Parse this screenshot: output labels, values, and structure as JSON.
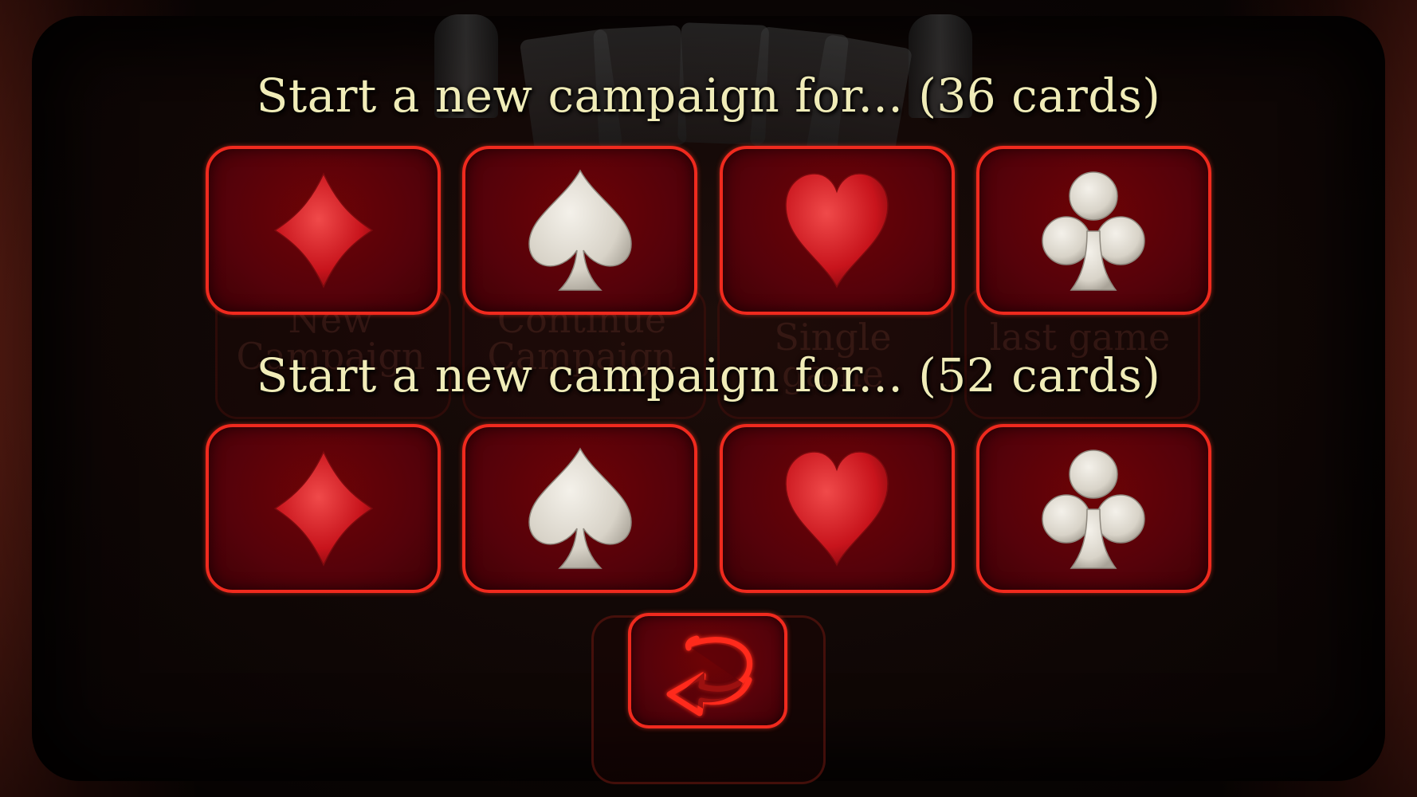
{
  "menu": {
    "heading_36": "Start a new campaign for... (36 cards)",
    "heading_52": "Start a new campaign for... (52 cards)",
    "suits": [
      "diamonds",
      "spades",
      "hearts",
      "clubs"
    ],
    "back_icon": "return-arrow-icon"
  },
  "background_menu": {
    "labels": [
      "New Campaign",
      "Continue Campaign",
      "Single game",
      "last game"
    ]
  },
  "colors": {
    "button_border": "#f02a1e",
    "button_fill": "#55020a",
    "heading_text": "#f0ecb8",
    "red_suit": "#d8202a",
    "white_suit": "#e4e0d8"
  }
}
